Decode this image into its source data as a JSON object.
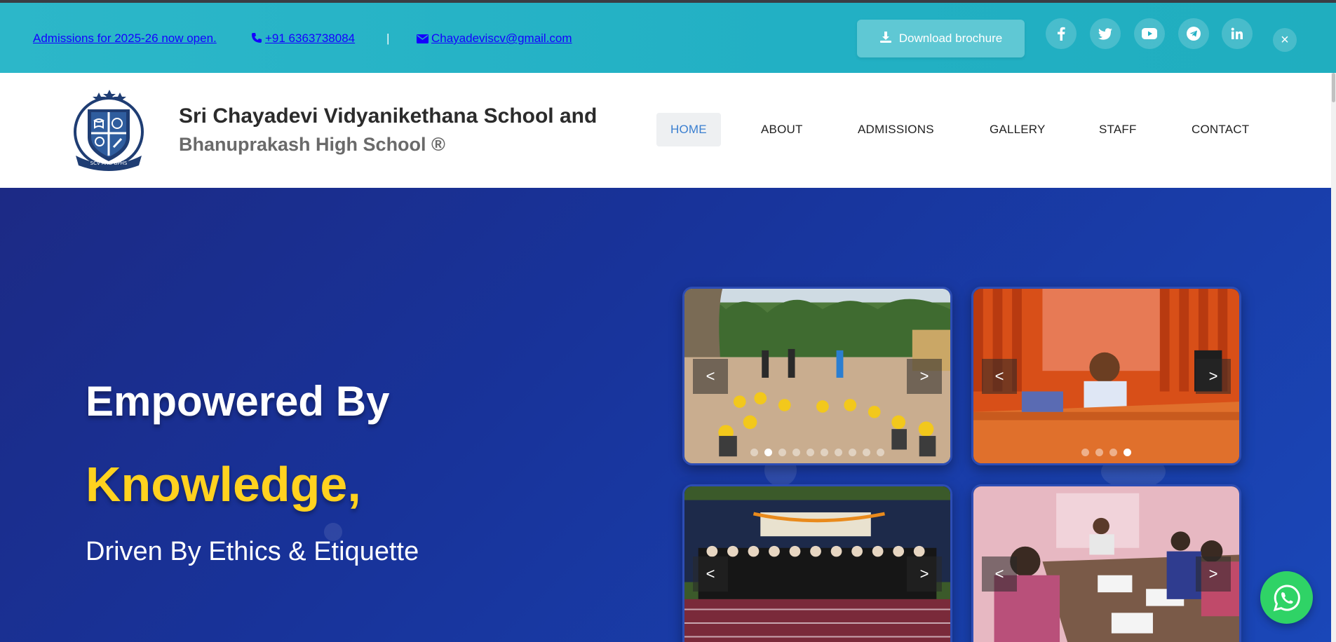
{
  "topbar": {
    "admission_text": "Admissions for 2025-26 now open.",
    "phone": "+91 6363738084",
    "separator": "|",
    "email": "Chayadeviscv@gmail.com",
    "brochure_label": "Download brochure",
    "close_symbol": "×",
    "socials": [
      "facebook-icon",
      "twitter-icon",
      "youtube-icon",
      "telegram-icon",
      "linkedin-icon"
    ],
    "colors": {
      "bar": "#22b0c4",
      "link": "#1400ff"
    }
  },
  "header": {
    "school_name_line1": "Sri Chayadevi Vidyanikethana School and",
    "school_name_line2": "Bhanuprakash High School ®",
    "logo_caption": "SCV AND BPHS",
    "nav": [
      {
        "label": "HOME",
        "active": true
      },
      {
        "label": "ABOUT",
        "active": false
      },
      {
        "label": "ADMISSIONS",
        "active": false
      },
      {
        "label": "GALLERY",
        "active": false
      },
      {
        "label": "STAFF",
        "active": false
      },
      {
        "label": "CONTACT",
        "active": false
      }
    ]
  },
  "hero": {
    "line1": "Empowered By",
    "line2": "Knowledge,",
    "line3": "Driven By Ethics & Etiquette",
    "accent_color": "#ffd21f",
    "carousels": [
      {
        "name": "outdoor-activity",
        "prev": "<",
        "next": ">",
        "dots": 10,
        "active_dot": 0
      },
      {
        "name": "principal-office",
        "prev": "<",
        "next": ">",
        "dots": 4,
        "active_dot": 3
      },
      {
        "name": "graduation-group",
        "prev": "<",
        "next": ">",
        "dots": 0,
        "active_dot": 0
      },
      {
        "name": "staff-meeting",
        "prev": "<",
        "next": ">",
        "dots": 0,
        "active_dot": 0
      }
    ]
  },
  "floating": {
    "whatsapp_icon": "whatsapp-icon"
  }
}
